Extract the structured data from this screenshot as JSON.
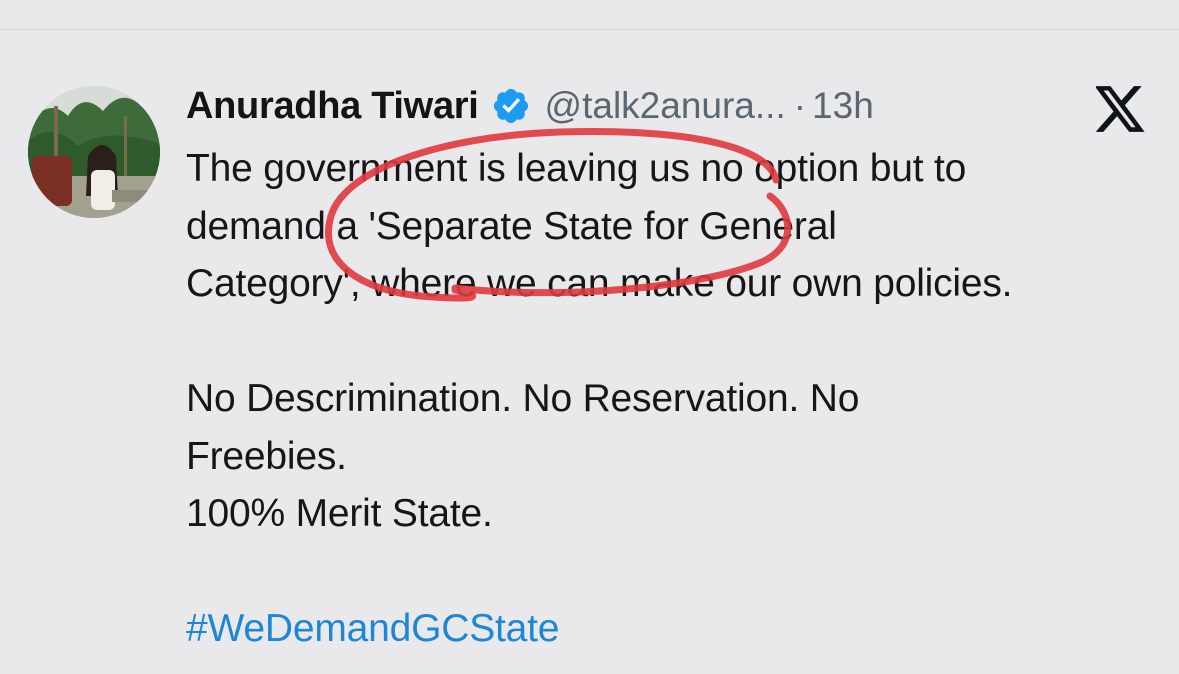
{
  "tweet": {
    "author_name": "Anuradha Tiwari",
    "handle": "@talk2anura...",
    "separator": "·",
    "time": "13h",
    "lines": [
      "The government is leaving us no option but to",
      "demand a 'Separate State for General",
      "Category', where we can make our own policies.",
      "",
      "No Descrimination. No Reservation. No",
      "Freebies.",
      "100% Merit State.",
      ""
    ],
    "hashtag": "#WeDemandGCState"
  },
  "icons": {
    "verified": "verified-badge-icon",
    "platform": "x-logo-icon"
  },
  "colors": {
    "background": "#e9e9eb",
    "hashtag": "#1d87d6",
    "verified": "#1d9bf0",
    "annotation": "#e0393e"
  }
}
